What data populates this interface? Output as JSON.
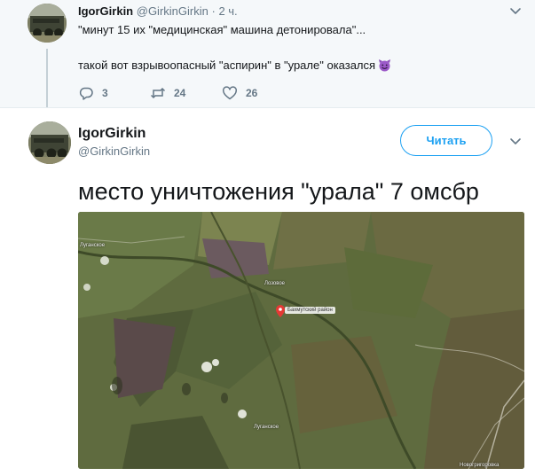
{
  "parent_tweet": {
    "name": "IgorGirkin",
    "handle": "@GirkinGirkin",
    "separator": "·",
    "time": "2 ч.",
    "line1": "\"минут 15 их \"медицинская\" машина детонировала\"...",
    "line2": "такой вот взрывоопасный \"аспирин\" в \"урале\" оказался",
    "emoji": "smiling-imp",
    "replies": "3",
    "retweets": "24",
    "likes": "26"
  },
  "main_tweet": {
    "name": "IgorGirkin",
    "handle": "@GirkinGirkin",
    "follow_label": "Читать",
    "text": "место уничтожения \"урала\" 7 омсбр"
  },
  "map": {
    "pin_label": "Бахмутский район",
    "labels": [
      "Луганское",
      "Лозовое",
      "Луганское",
      "Новогригоровка"
    ]
  },
  "colors": {
    "accent": "#1da1f2",
    "secondary_text": "#657786",
    "parent_bg": "#f5f8fa"
  }
}
